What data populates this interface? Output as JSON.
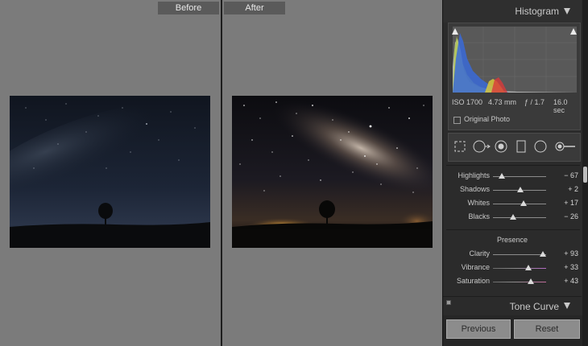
{
  "compare": {
    "before_label": "Before",
    "after_label": "After"
  },
  "histogram": {
    "title": "Histogram",
    "iso": "ISO 1700",
    "focal_length": "4.73 mm",
    "aperture": "ƒ / 1.7",
    "shutter": "16.0 sec",
    "original_photo_label": "Original Photo",
    "original_photo_checked": false
  },
  "tools": [
    "crop-tool",
    "spot-removal-tool",
    "red-eye-tool",
    "graduated-filter-tool",
    "radial-filter-tool",
    "adjustment-brush-tool"
  ],
  "tone": {
    "sliders": [
      {
        "label": "Highlights",
        "value": "− 67",
        "position": 0.17
      },
      {
        "label": "Shadows",
        "value": "+ 2",
        "position": 0.51
      },
      {
        "label": "Whites",
        "value": "+ 17",
        "position": 0.58
      },
      {
        "label": "Blacks",
        "value": "− 26",
        "position": 0.38
      }
    ]
  },
  "presence": {
    "title": "Presence",
    "sliders": [
      {
        "label": "Clarity",
        "value": "+ 93",
        "position": 0.94
      },
      {
        "label": "Vibrance",
        "value": "+ 33",
        "position": 0.66
      },
      {
        "label": "Saturation",
        "value": "+ 43",
        "position": 0.71
      }
    ]
  },
  "tone_curve": {
    "title": "Tone Curve"
  },
  "buttons": {
    "previous": "Previous",
    "reset": "Reset"
  }
}
